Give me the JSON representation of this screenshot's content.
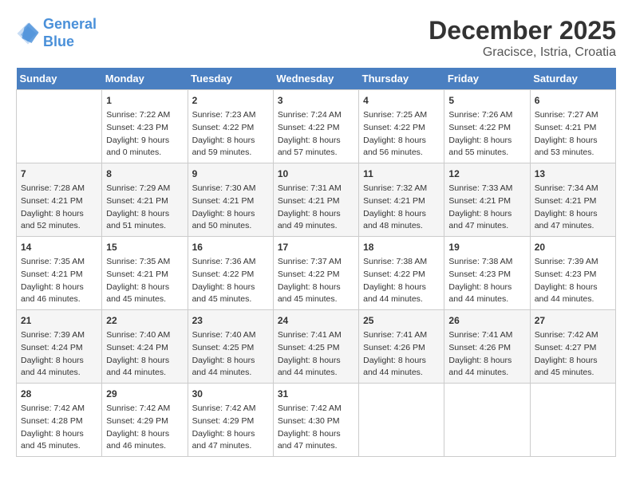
{
  "header": {
    "logo_line1": "General",
    "logo_line2": "Blue",
    "month": "December 2025",
    "location": "Gracisce, Istria, Croatia"
  },
  "days_of_week": [
    "Sunday",
    "Monday",
    "Tuesday",
    "Wednesday",
    "Thursday",
    "Friday",
    "Saturday"
  ],
  "weeks": [
    [
      {
        "day": "",
        "content": ""
      },
      {
        "day": "1",
        "content": "Sunrise: 7:22 AM\nSunset: 4:23 PM\nDaylight: 9 hours\nand 0 minutes."
      },
      {
        "day": "2",
        "content": "Sunrise: 7:23 AM\nSunset: 4:22 PM\nDaylight: 8 hours\nand 59 minutes."
      },
      {
        "day": "3",
        "content": "Sunrise: 7:24 AM\nSunset: 4:22 PM\nDaylight: 8 hours\nand 57 minutes."
      },
      {
        "day": "4",
        "content": "Sunrise: 7:25 AM\nSunset: 4:22 PM\nDaylight: 8 hours\nand 56 minutes."
      },
      {
        "day": "5",
        "content": "Sunrise: 7:26 AM\nSunset: 4:22 PM\nDaylight: 8 hours\nand 55 minutes."
      },
      {
        "day": "6",
        "content": "Sunrise: 7:27 AM\nSunset: 4:21 PM\nDaylight: 8 hours\nand 53 minutes."
      }
    ],
    [
      {
        "day": "7",
        "content": "Sunrise: 7:28 AM\nSunset: 4:21 PM\nDaylight: 8 hours\nand 52 minutes."
      },
      {
        "day": "8",
        "content": "Sunrise: 7:29 AM\nSunset: 4:21 PM\nDaylight: 8 hours\nand 51 minutes."
      },
      {
        "day": "9",
        "content": "Sunrise: 7:30 AM\nSunset: 4:21 PM\nDaylight: 8 hours\nand 50 minutes."
      },
      {
        "day": "10",
        "content": "Sunrise: 7:31 AM\nSunset: 4:21 PM\nDaylight: 8 hours\nand 49 minutes."
      },
      {
        "day": "11",
        "content": "Sunrise: 7:32 AM\nSunset: 4:21 PM\nDaylight: 8 hours\nand 48 minutes."
      },
      {
        "day": "12",
        "content": "Sunrise: 7:33 AM\nSunset: 4:21 PM\nDaylight: 8 hours\nand 47 minutes."
      },
      {
        "day": "13",
        "content": "Sunrise: 7:34 AM\nSunset: 4:21 PM\nDaylight: 8 hours\nand 47 minutes."
      }
    ],
    [
      {
        "day": "14",
        "content": "Sunrise: 7:35 AM\nSunset: 4:21 PM\nDaylight: 8 hours\nand 46 minutes."
      },
      {
        "day": "15",
        "content": "Sunrise: 7:35 AM\nSunset: 4:21 PM\nDaylight: 8 hours\nand 45 minutes."
      },
      {
        "day": "16",
        "content": "Sunrise: 7:36 AM\nSunset: 4:22 PM\nDaylight: 8 hours\nand 45 minutes."
      },
      {
        "day": "17",
        "content": "Sunrise: 7:37 AM\nSunset: 4:22 PM\nDaylight: 8 hours\nand 45 minutes."
      },
      {
        "day": "18",
        "content": "Sunrise: 7:38 AM\nSunset: 4:22 PM\nDaylight: 8 hours\nand 44 minutes."
      },
      {
        "day": "19",
        "content": "Sunrise: 7:38 AM\nSunset: 4:23 PM\nDaylight: 8 hours\nand 44 minutes."
      },
      {
        "day": "20",
        "content": "Sunrise: 7:39 AM\nSunset: 4:23 PM\nDaylight: 8 hours\nand 44 minutes."
      }
    ],
    [
      {
        "day": "21",
        "content": "Sunrise: 7:39 AM\nSunset: 4:24 PM\nDaylight: 8 hours\nand 44 minutes."
      },
      {
        "day": "22",
        "content": "Sunrise: 7:40 AM\nSunset: 4:24 PM\nDaylight: 8 hours\nand 44 minutes."
      },
      {
        "day": "23",
        "content": "Sunrise: 7:40 AM\nSunset: 4:25 PM\nDaylight: 8 hours\nand 44 minutes."
      },
      {
        "day": "24",
        "content": "Sunrise: 7:41 AM\nSunset: 4:25 PM\nDaylight: 8 hours\nand 44 minutes."
      },
      {
        "day": "25",
        "content": "Sunrise: 7:41 AM\nSunset: 4:26 PM\nDaylight: 8 hours\nand 44 minutes."
      },
      {
        "day": "26",
        "content": "Sunrise: 7:41 AM\nSunset: 4:26 PM\nDaylight: 8 hours\nand 44 minutes."
      },
      {
        "day": "27",
        "content": "Sunrise: 7:42 AM\nSunset: 4:27 PM\nDaylight: 8 hours\nand 45 minutes."
      }
    ],
    [
      {
        "day": "28",
        "content": "Sunrise: 7:42 AM\nSunset: 4:28 PM\nDaylight: 8 hours\nand 45 minutes."
      },
      {
        "day": "29",
        "content": "Sunrise: 7:42 AM\nSunset: 4:29 PM\nDaylight: 8 hours\nand 46 minutes."
      },
      {
        "day": "30",
        "content": "Sunrise: 7:42 AM\nSunset: 4:29 PM\nDaylight: 8 hours\nand 47 minutes."
      },
      {
        "day": "31",
        "content": "Sunrise: 7:42 AM\nSunset: 4:30 PM\nDaylight: 8 hours\nand 47 minutes."
      },
      {
        "day": "",
        "content": ""
      },
      {
        "day": "",
        "content": ""
      },
      {
        "day": "",
        "content": ""
      }
    ]
  ]
}
